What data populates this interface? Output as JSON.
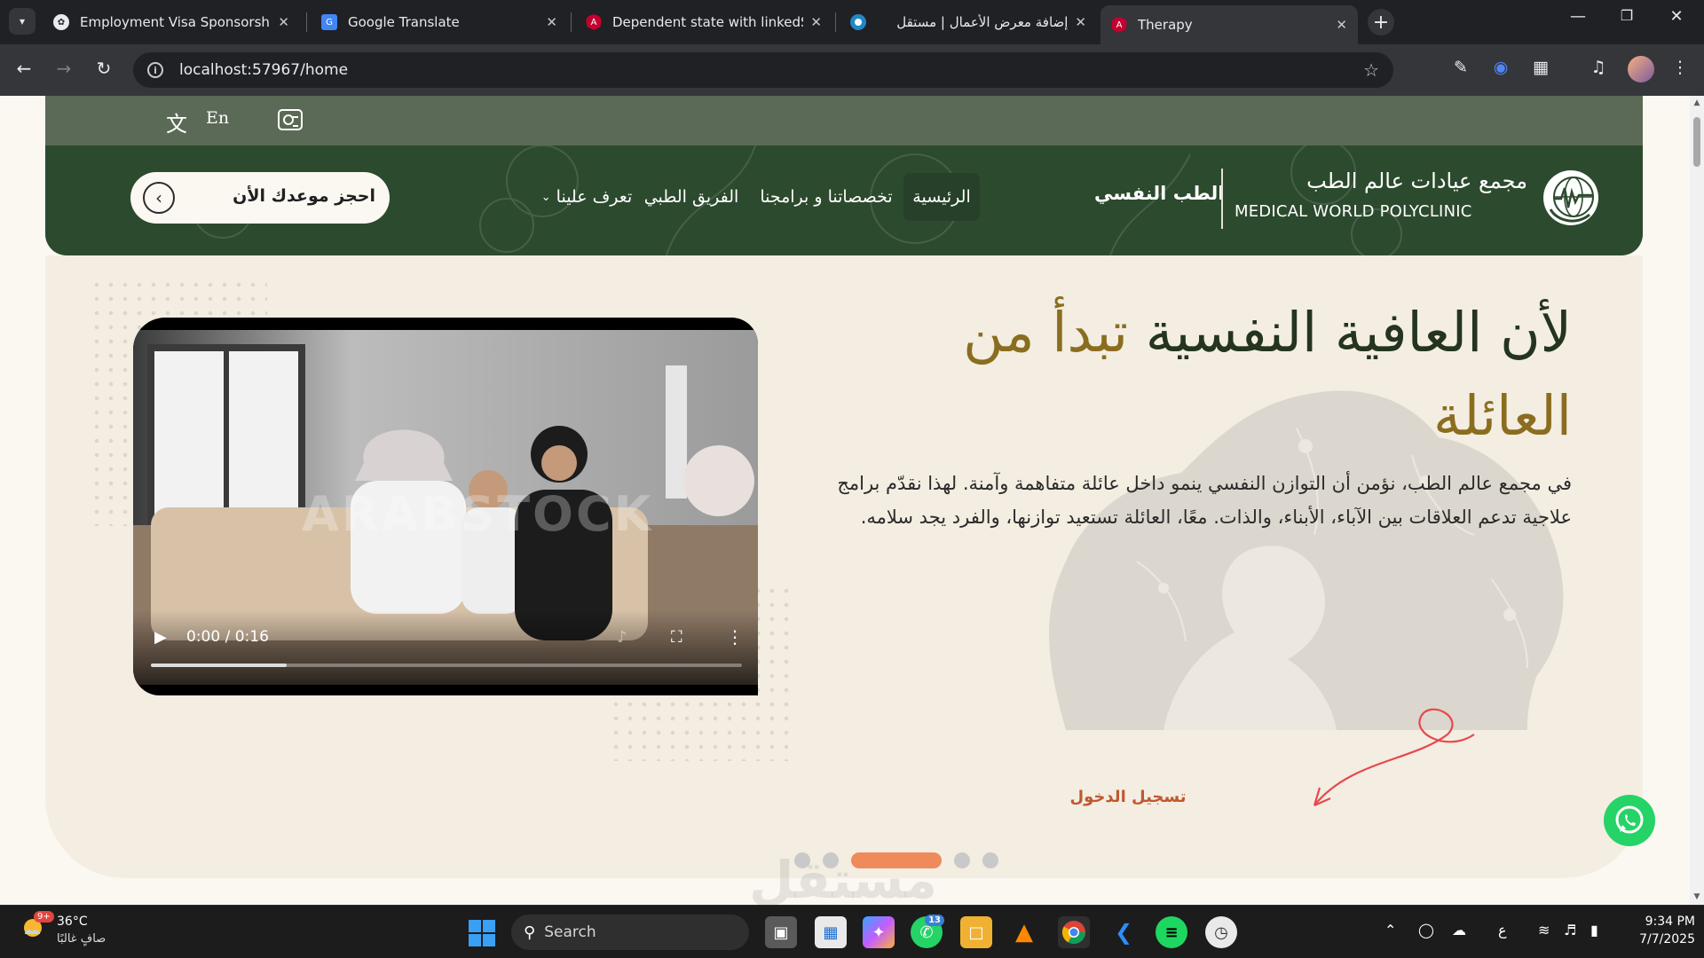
{
  "browser": {
    "tabs": [
      {
        "title": "Employment Visa Sponsorship",
        "favicon": "openai-icon"
      },
      {
        "title": "Google Translate",
        "favicon": "google-translate-icon"
      },
      {
        "title": "Dependent state with linkedSig",
        "favicon": "angular-icon"
      },
      {
        "title": "إضافة معرض الأعمال | مستقل",
        "favicon": "mostaql-icon"
      },
      {
        "title": "Therapy",
        "favicon": "angular-icon",
        "active": true
      }
    ],
    "url": "localhost:57967/home",
    "colors": {
      "tabbar": "#202124",
      "toolbar": "#35363a"
    }
  },
  "page": {
    "topbar": {
      "lang_label": "En"
    },
    "header": {
      "book_button": "احجز موعدك الأن",
      "menu": {
        "about": "تعرف علينا",
        "team": "الفريق الطبي",
        "specialties": "تخصصاتنا و برامجنا",
        "home": "الرئيسية"
      },
      "brand_sub": "الطب النفسي",
      "brand_ar": "مجمع عيادات عالم الطب",
      "brand_en": "MEDICAL WORLD POLYCLINIC",
      "colors": {
        "header": "#2c4a2e",
        "topstrip": "#5b6a56"
      }
    },
    "hero": {
      "title_part1": "لأن العافية النفسية",
      "title_accent": "تبدأ من العائلة",
      "body": "في مجمع عالم الطب، نؤمن أن التوازن النفسي ينمو داخل عائلة متفاهمة وآمنة. لهذا نقدّم برامج علاجية تدعم العلاقات بين الآباء، الأبناء، والذات. معًا، العائلة تستعيد توازنها، والفرد يجد سلامه.",
      "login_link": "تسجيل الدخول",
      "video": {
        "time": "0:00 / 0:16",
        "watermark": "ARABSTOCK",
        "progress": 0.23
      },
      "slides": {
        "count": 5,
        "active": 3
      },
      "colors": {
        "accent": "#8a6d1f",
        "cta": "#ef8a5b",
        "link": "#c0582e"
      }
    },
    "watermark": "مستقل"
  },
  "taskbar": {
    "weather_temp": "36°C",
    "weather_desc": "صافٍ غالبًا",
    "weather_badge": "9+",
    "search_label": "Search",
    "whatsapp_badge": "13",
    "input_lang": "ع",
    "time": "9:34 PM",
    "date": "7/7/2025"
  }
}
